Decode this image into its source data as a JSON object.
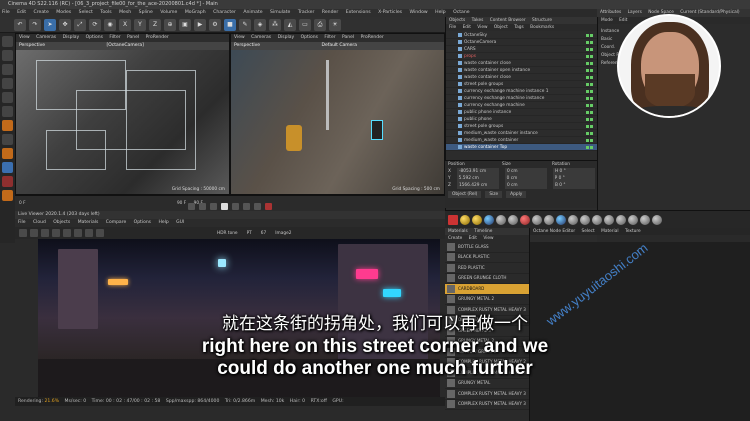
{
  "window": {
    "title": "Cinema 4D S22.116 (RC) - [06_3_project_file00_for_the_ace-20200801.c4d *] - Main"
  },
  "menubar": [
    "File",
    "Edit",
    "Create",
    "Modes",
    "Select",
    "Tools",
    "Mesh",
    "Spline",
    "Volume",
    "MoGraph",
    "Character",
    "Animate",
    "Simulate",
    "Tracker",
    "Render",
    "Extensions",
    "X-Particles",
    "Window",
    "Help",
    "Octane"
  ],
  "toolbar": {
    "axis_labels": [
      "X",
      "Y",
      "Z"
    ]
  },
  "viewport1": {
    "menu": [
      "View",
      "Render Settings",
      "Picture Viewer",
      "Render Queue"
    ],
    "header": [
      "View",
      "Cameras",
      "Display",
      "Options",
      "Filter",
      "Panel",
      "ProRender"
    ],
    "label": "Perspective",
    "camera": "[OctaneCamera]",
    "grid": "Grid Spacing : 50000 cm"
  },
  "viewport2": {
    "header": [
      "View",
      "Cameras",
      "Display",
      "Options",
      "Filter",
      "Panel",
      "ProRender"
    ],
    "label": "Perspective",
    "camera": "Default Camera",
    "grid": "Grid Spacing : 500 cm"
  },
  "timeline": {
    "start": "0 F",
    "end": "90 F",
    "current": "90 F"
  },
  "live_viewer": {
    "title": "Live Viewer 2020.1.4 (203 days left)",
    "menu": [
      "File",
      "Cloud",
      "Objects",
      "Materials",
      "Compare",
      "Options",
      "Help",
      "GUI"
    ],
    "tonemap": "HDR tone",
    "pass": "PT",
    "frame": "67",
    "mode": "Image2",
    "status": {
      "rendering_label": "Rendering:",
      "rendering_value": "21.6%",
      "ms_sec": "Ms/sec: 0",
      "time": "Time: 00 : 02 : 47/00 : 02 : 58",
      "spp": "Spp/maxspp: 864/4000",
      "tri": "Tri: 0/2.866m",
      "mesh": "Mesh: 10k",
      "hair": "Hair: 0",
      "rtx": "RTX:off",
      "gpu": "GPU:"
    }
  },
  "objects_panel": {
    "tabs": [
      "Objects",
      "Takes",
      "Content Browser",
      "Structure"
    ],
    "menu": [
      "File",
      "Edit",
      "View",
      "Object",
      "Tags",
      "Bookmarks"
    ],
    "items": [
      {
        "label": "OctaneSky",
        "state": "normal"
      },
      {
        "label": "OctaneCamera",
        "state": "normal"
      },
      {
        "label": "CARS",
        "state": "normal"
      },
      {
        "label": "props",
        "state": "red"
      },
      {
        "label": "waste container close",
        "state": "normal"
      },
      {
        "label": "waste container open instance",
        "state": "normal"
      },
      {
        "label": "waste container close",
        "state": "normal"
      },
      {
        "label": "street pole groups",
        "state": "normal"
      },
      {
        "label": "currency exchange machine instance 1",
        "state": "normal"
      },
      {
        "label": "currency exchange machine instance",
        "state": "normal"
      },
      {
        "label": "currency exchange machine",
        "state": "normal"
      },
      {
        "label": "public phone instance",
        "state": "normal"
      },
      {
        "label": "public phone",
        "state": "normal"
      },
      {
        "label": "street pole groups",
        "state": "normal"
      },
      {
        "label": "medium_waste container instance",
        "state": "normal"
      },
      {
        "label": "medium_waste container",
        "state": "normal"
      },
      {
        "label": "waste container Top",
        "state": "selected"
      }
    ]
  },
  "coordinates": {
    "headers": [
      "Position",
      "Size",
      "Rotation"
    ],
    "rows": [
      {
        "axis": "X",
        "pos": "-8053.91 cm",
        "size": "0 cm",
        "rot": "H  0 °"
      },
      {
        "axis": "Y",
        "pos": "5.592 cm",
        "size": "0 cm",
        "rot": "P  0 °"
      },
      {
        "axis": "Z",
        "pos": "1566.429 cm",
        "size": "0 cm",
        "rot": "B  0 °"
      }
    ],
    "mode": "Object (Rel)",
    "size_mode": "Size",
    "apply": "Apply"
  },
  "attributes": {
    "tabs": [
      "Attributes",
      "Layers"
    ],
    "node_space_label": "Node Space",
    "node_space_value": "Current (Standard/Physical)",
    "layout_label": "Layout",
    "layout_value": "Startup (User)",
    "menu": [
      "Mode",
      "Edit"
    ],
    "labels": [
      "Instance",
      "Basic",
      "Coord.",
      "Object Pro",
      "Reference"
    ]
  },
  "materials": {
    "tabs": [
      "Materials",
      "Timeline",
      "Octane Node Editor"
    ],
    "menu": [
      "Create",
      "Edit",
      "View",
      "Select",
      "Material",
      "Texture"
    ],
    "items": [
      {
        "label": "BOTTLE GLASS",
        "selected": false
      },
      {
        "label": "BLACK PLASTIC",
        "selected": false
      },
      {
        "label": "RED PLASTIC",
        "selected": false
      },
      {
        "label": "GREEN GRUNGE CLOTH",
        "selected": false
      },
      {
        "label": "CARDBOARD",
        "selected": true
      },
      {
        "label": "GRUNGY METAL 2",
        "selected": false
      },
      {
        "label": "COMPLEX RUSTY METAL HEAVY 3",
        "selected": false
      },
      {
        "label": "OLD METAL",
        "selected": false
      },
      {
        "label": "GREEN METAL 3",
        "selected": false
      },
      {
        "label": "GRUNGY METAL 2",
        "selected": false
      },
      {
        "label": "WINDOW GRILLE 2",
        "selected": false
      },
      {
        "label": "COMPLEX RUSTY METAL HEAVY 2",
        "selected": false
      },
      {
        "label": "COMPLEX RUSTY METAL HEAVY 3",
        "selected": false
      },
      {
        "label": "GRUNGY METAL",
        "selected": false
      },
      {
        "label": "COMPLEX RUSTY METAL HEAVY 3",
        "selected": false
      },
      {
        "label": "COMPLEX RUSTY METAL HEAVY 3",
        "selected": false
      }
    ]
  },
  "subtitle": {
    "chinese": "就在这条街的拐角处，我们可以再做一个",
    "english_line1": "right here on this street corner and we",
    "english_line2": "could do another one much further"
  },
  "watermark": "www.yuyuitaoshi.com"
}
